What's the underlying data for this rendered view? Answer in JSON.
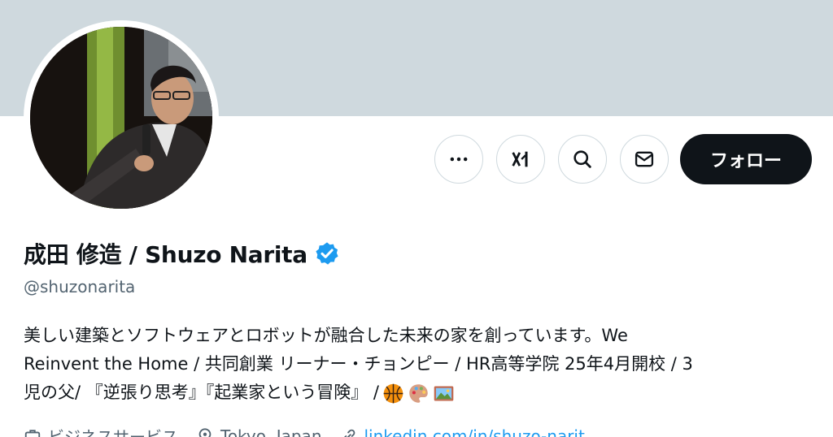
{
  "profile": {
    "display_name": "成田 修造 / Shuzo Narita",
    "handle": "@shuzonarita",
    "verified": true,
    "bio_lines": [
      "美しい建築とソフトウェアとロボットが融合した未来の家を創っています。We",
      "Reinvent the Home / 共同創業 リーナー・チョンピー / HR高等学院 25年4月開校 / 3",
      "児の父/ 『逆張り思考』『起業家という冒険』 /"
    ],
    "bio_emojis": [
      "basketball-icon",
      "palette-icon",
      "picture-icon"
    ],
    "meta": {
      "category": "ビジネスサービス",
      "location": "Tokyo, Japan",
      "website": "linkedin.com/in/shuzo-narit"
    }
  },
  "actions": {
    "more_label": "…",
    "grok_label": "Grok",
    "search_label": "検索",
    "message_label": "メッセージ",
    "follow_label": "フォロー"
  },
  "colors": {
    "banner": "#cfd9de",
    "verified": "#1d9bf0",
    "follow_bg": "#0f1419",
    "link": "#1d9bf0",
    "secondary_text": "#536471"
  }
}
